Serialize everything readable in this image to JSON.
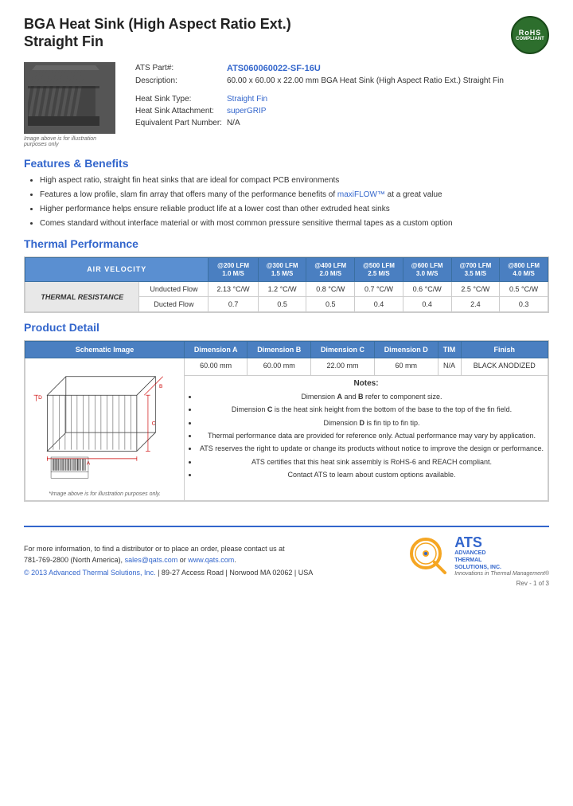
{
  "page": {
    "title_line1": "BGA Heat Sink (High Aspect Ratio Ext.)",
    "title_line2": "Straight Fin",
    "rohs": "RoHS\nCOMPLIANT",
    "image_caption": "Image above is for illustration purposes only",
    "part_number_label": "ATS Part#:",
    "part_number_value": "ATS060060022-SF-16U",
    "description_label": "Description:",
    "description_value": "60.00 x 60.00 x 22.00 mm BGA Heat Sink (High Aspect Ratio Ext.) Straight Fin",
    "heat_sink_type_label": "Heat Sink Type:",
    "heat_sink_type_value": "Straight Fin",
    "attachment_label": "Heat Sink Attachment:",
    "attachment_value": "superGRIP",
    "equiv_part_label": "Equivalent Part Number:",
    "equiv_part_value": "N/A",
    "features_title": "Features & Benefits",
    "features": [
      "High aspect ratio, straight fin heat sinks that are ideal for compact PCB environments",
      "Features a low profile, slam fin array that offers many of the performance benefits of maxiFLOW™ at a great value",
      "Higher performance helps ensure reliable product life at a lower cost than other extruded heat sinks",
      "Comes standard without interface material or with most common pressure sensitive thermal tapes as a custom option"
    ],
    "thermal_title": "Thermal Performance",
    "thermal_table": {
      "header_air_velocity": "AIR VELOCITY",
      "columns": [
        {
          "lfm": "@200 LFM",
          "ms": "1.0 M/S"
        },
        {
          "lfm": "@300 LFM",
          "ms": "1.5 M/S"
        },
        {
          "lfm": "@400 LFM",
          "ms": "2.0 M/S"
        },
        {
          "lfm": "@500 LFM",
          "ms": "2.5 M/S"
        },
        {
          "lfm": "@600 LFM",
          "ms": "3.0 M/S"
        },
        {
          "lfm": "@700 LFM",
          "ms": "3.5 M/S"
        },
        {
          "lfm": "@800 LFM",
          "ms": "4.0 M/S"
        }
      ],
      "row_label": "THERMAL RESISTANCE",
      "unducted_label": "Unducted Flow",
      "unducted_values": [
        "2.13 °C/W",
        "1.2 °C/W",
        "0.8 °C/W",
        "0.7 °C/W",
        "0.6 °C/W",
        "2.5 °C/W",
        "0.5 °C/W"
      ],
      "ducted_label": "Ducted Flow",
      "ducted_values": [
        "0.7",
        "0.5",
        "0.5",
        "0.4",
        "0.4",
        "2.4",
        "0.3"
      ]
    },
    "product_detail_title": "Product Detail",
    "product_detail_table": {
      "headers": [
        "Schematic Image",
        "Dimension A",
        "Dimension B",
        "Dimension C",
        "Dimension D",
        "TIM",
        "Finish"
      ],
      "dim_values": [
        "60.00 mm",
        "60.00 mm",
        "22.00 mm",
        "60 mm",
        "N/A",
        "BLACK ANODIZED"
      ],
      "schematic_caption": "*Image above is for illustration purposes only.",
      "notes_title": "Notes:",
      "notes": [
        "Dimension A and B refer to component size.",
        "Dimension C is the heat sink height from the bottom of the base to the top of the fin field.",
        "Dimension D is fin tip to fin tip.",
        "Thermal performance data are provided for reference only. Actual performance may vary by application.",
        "ATS reserves the right to update or change its products without notice to improve the design or performance.",
        "ATS certifies that this heat sink assembly is RoHS-6 and REACH compliant.",
        "Contact ATS to learn about custom options available."
      ]
    },
    "footer": {
      "contact_text": "For more information, to find a distributor or to place an order, please contact us at",
      "phone": "781-769-2800 (North America),",
      "email": "sales@qats.com",
      "email_join": " or ",
      "website": "www.qats.com",
      "copyright": "© 2013 Advanced Thermal Solutions, Inc.",
      "address": "| 89-27 Access Road | Norwood MA  02062 | USA",
      "ats_name": "ATS",
      "ats_fullname_line1": "ADVANCED",
      "ats_fullname_line2": "THERMAL",
      "ats_fullname_line3": "SOLUTIONS, INC.",
      "ats_tagline": "Innovations in Thermal Management®",
      "page_number": "Rev - 1 of 3"
    }
  }
}
